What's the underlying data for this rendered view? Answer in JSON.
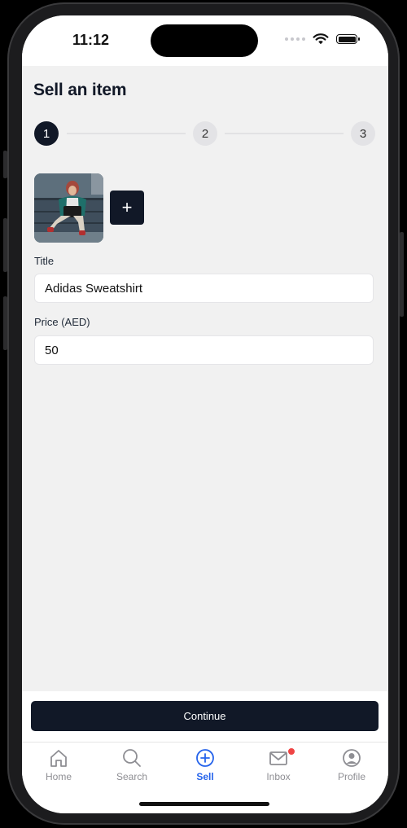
{
  "status_bar": {
    "time": "11:12"
  },
  "page": {
    "title": "Sell an item"
  },
  "stepper": {
    "steps": [
      "1",
      "2",
      "3"
    ],
    "active_step": 1
  },
  "form": {
    "title_label": "Title",
    "title_value": "Adidas Sweatshirt",
    "price_label": "Price (AED)",
    "price_value": "50",
    "add_photo_label": "+"
  },
  "actions": {
    "continue_label": "Continue"
  },
  "tab_bar": {
    "items": [
      {
        "label": "Home",
        "icon": "home-icon"
      },
      {
        "label": "Search",
        "icon": "search-icon"
      },
      {
        "label": "Sell",
        "icon": "plus-circle-icon",
        "active": true
      },
      {
        "label": "Inbox",
        "icon": "mail-icon",
        "badge": true
      },
      {
        "label": "Profile",
        "icon": "user-circle-icon"
      }
    ]
  },
  "colors": {
    "primary_dark": "#111827",
    "accent_blue": "#2563eb",
    "badge_red": "#ef4444",
    "background": "#f1f1f1"
  }
}
